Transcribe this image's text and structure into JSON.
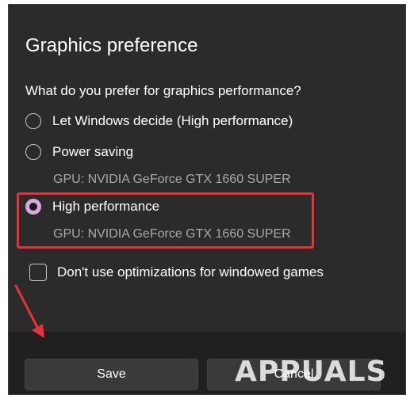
{
  "dialog": {
    "title": "Graphics preference",
    "question": "What do you prefer for graphics performance?",
    "options": [
      {
        "label": "Let Windows decide (High performance)",
        "checked": false
      },
      {
        "label": "Power saving",
        "gpu": "GPU: NVIDIA GeForce GTX 1660 SUPER",
        "checked": false
      },
      {
        "label": "High performance",
        "gpu": "GPU: NVIDIA GeForce GTX 1660 SUPER",
        "checked": true
      }
    ],
    "checkbox": {
      "label": "Don't use optimizations for windowed games",
      "checked": false
    },
    "buttons": {
      "save": "Save",
      "cancel": "Cancel"
    }
  },
  "watermark": "APPUALS",
  "colors": {
    "dialog_bg": "#2b2b2b",
    "footer_bg": "#202020",
    "accent_radio": "#d8a9dd",
    "annotation_red": "#e8313b"
  }
}
